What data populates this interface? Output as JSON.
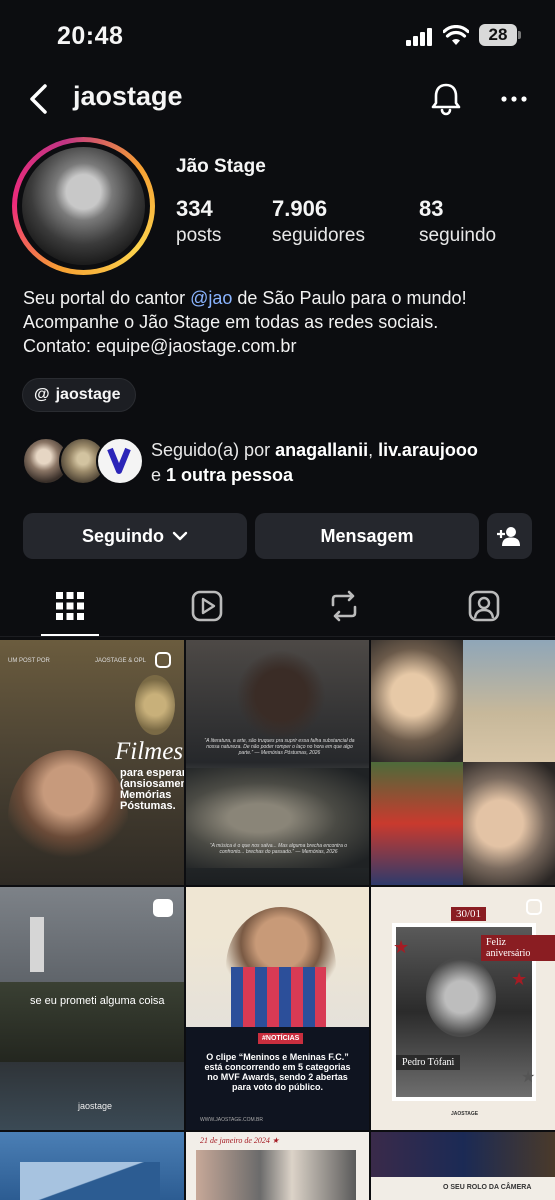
{
  "status_bar": {
    "time": "20:48",
    "battery": "28"
  },
  "header": {
    "username": "jaostage"
  },
  "profile": {
    "display_name": "Jão Stage",
    "stats": [
      {
        "value": "334",
        "label": "posts"
      },
      {
        "value": "7.906",
        "label": "seguidores"
      },
      {
        "value": "83",
        "label": "seguindo"
      }
    ],
    "bio": {
      "line1_before": "Seu portal do cantor ",
      "mention": "@jao",
      "line1_after": " de São Paulo para o mundo!",
      "line2": "Acompanhe o Jão Stage em todas as redes sociais.",
      "line3": "Contato: equipe@jaostage.com.br"
    },
    "threads_label": "jaostage",
    "followed_by": {
      "prefix": "Seguido(a) por ",
      "name1": "anagallanii",
      "sep": ", ",
      "name2": "liv.araujooo",
      "and": "e ",
      "others": "1 outra pessoa"
    }
  },
  "buttons": {
    "following": "Seguindo",
    "message": "Mensagem"
  },
  "posts": [
    {
      "top_left": "UM POST POR",
      "top_right": "JAOSTAGE & OPL",
      "title": "Filmes",
      "subtitle_lines": [
        "para esperar",
        "(ansiosamente)",
        "Memórias",
        "Póstumas."
      ]
    },
    {
      "caption_top": "“A literatura, a arte, são truques pra suprir essa falha substancial da nossa natureza. De não poder romper o laço no hora em que algo parte.” — Memórias Póstumas, 2026",
      "caption_bottom": "“A música é o que nos salva... Mas alguma brecha encontra o confronto... brechas do passado.” — Memórias, 2026"
    },
    {},
    {},
    {
      "caption": "se eu prometi alguma coisa",
      "footer": "jaostage"
    },
    {
      "tag": "#NOTÍCIAS",
      "headline": "O clipe “Meninos e Meninas F.C.” está concorrendo em 5 categorias no MVF Awards, sendo 2 abertas para voto do público.",
      "footer": "WWW.JAOSTAGE.COM.BR"
    },
    {
      "date": "30/01",
      "greeting": "Feliz aniversário",
      "name": "Pedro Tófani",
      "footer": "JAOSTAGE"
    },
    {
      "date": "21 de janeiro de 2024 ★"
    },
    {
      "caption": "O SEU ROLO DA CÂMERA"
    }
  ],
  "colors": {
    "background": "#0c0d10",
    "button": "#25272d",
    "mention": "#8ab4ff"
  }
}
